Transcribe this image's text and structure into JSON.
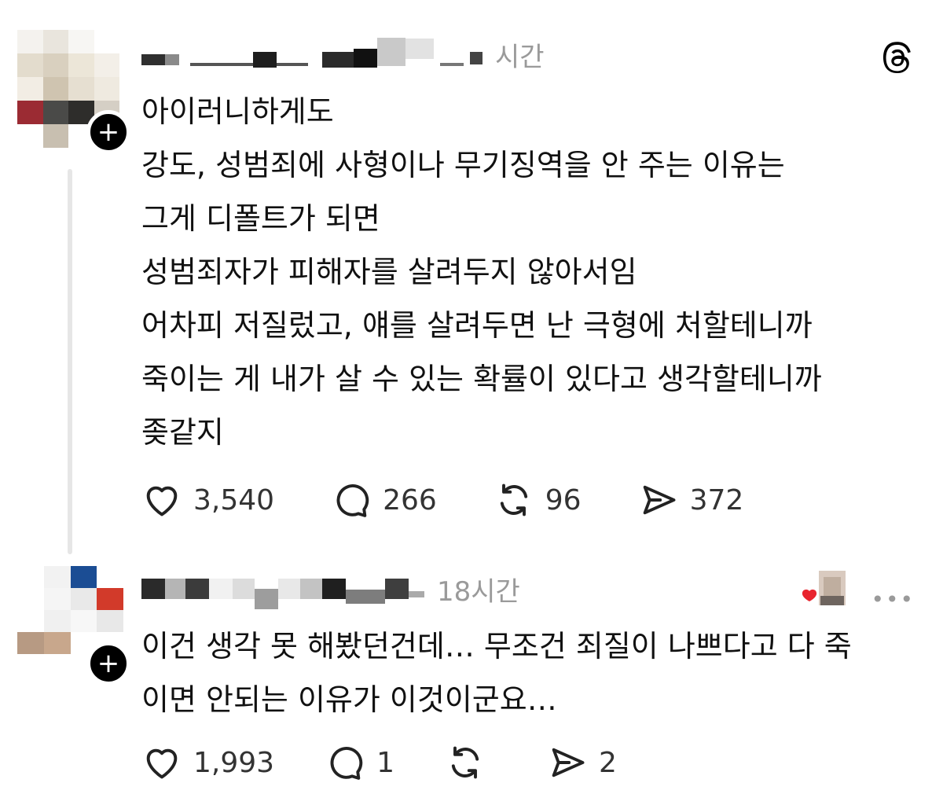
{
  "posts": [
    {
      "timestamp": "시간",
      "lines": [
        "아이러니하게도",
        "강도, 성범죄에 사형이나 무기징역을 안 주는 이유는",
        "그게 디폴트가 되면",
        "성범죄자가 피해자를 살려두지 않아서임",
        "어차피 저질렀고, 얘를 살려두면 난 극형에 처할테니까",
        "죽이는 게 내가 살 수 있는 확률이 있다고 생각할테니까",
        "좆같지"
      ],
      "actions": {
        "likes": "3,540",
        "replies": "266",
        "reposts": "96",
        "shares": "372"
      }
    },
    {
      "timestamp": "18시간",
      "lines": [
        "이건 생각 못 해봤던건데… 무조건 죄질이 나쁘다고 다 죽",
        "이면 안되는 이유가 이것이군요…"
      ],
      "actions": {
        "likes": "1,993",
        "replies": "1",
        "reposts": "",
        "shares": "2"
      }
    }
  ],
  "icons": {
    "logo": "threads-logo-icon",
    "like": "heart-icon",
    "reply": "comment-icon",
    "repost": "repost-icon",
    "share": "send-icon",
    "follow": "plus-icon",
    "more": "more-icon"
  },
  "more_label": "•••",
  "colors": {
    "text": "#111111",
    "muted": "#9a9a9a",
    "thread_line": "#e6e6e6"
  }
}
